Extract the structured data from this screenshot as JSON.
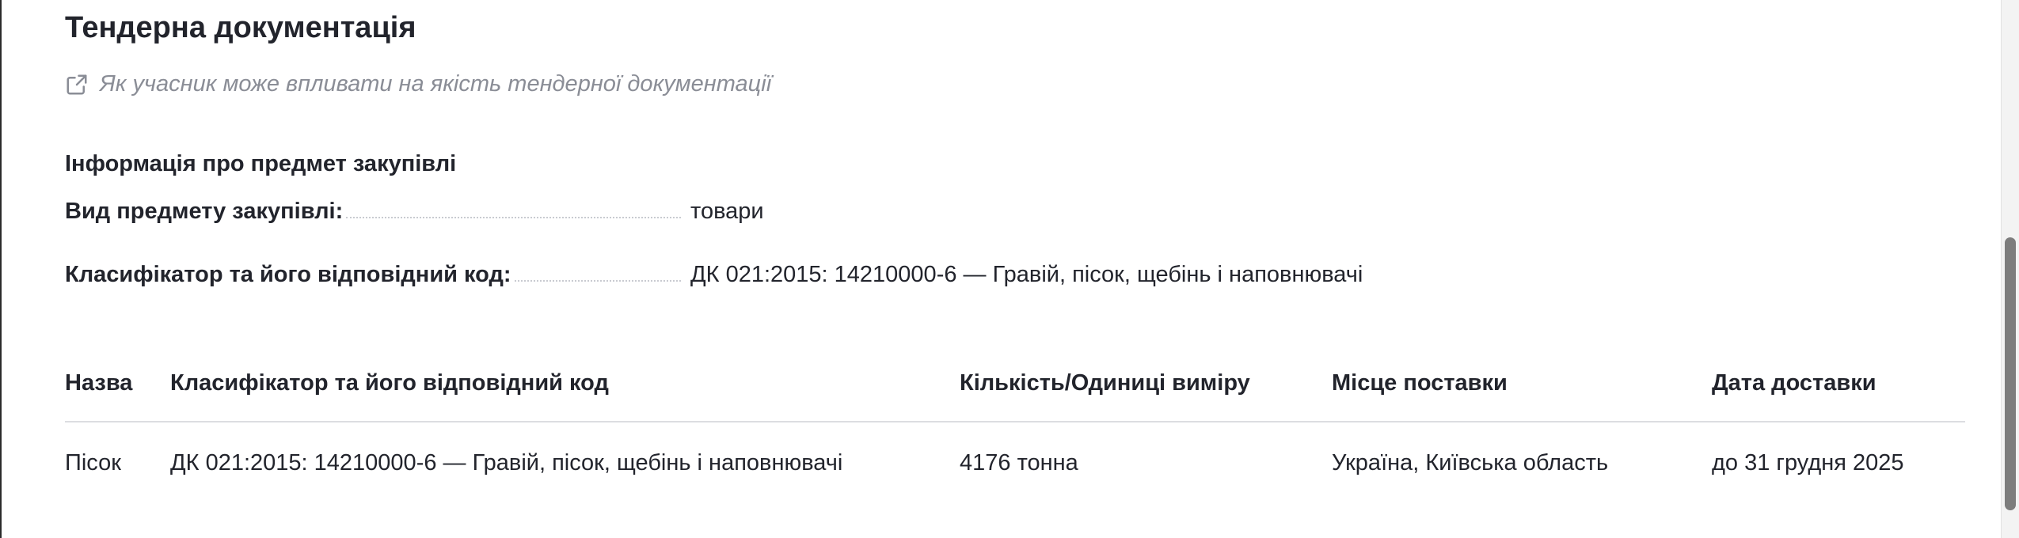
{
  "section": {
    "title": "Тендерна документація",
    "guide_link": "Як учасник може впливати на якість тендерної документації",
    "info_heading": "Інформація про предмет закупівлі",
    "fields": [
      {
        "label": "Вид предмету закупівлі:",
        "value": "товари"
      },
      {
        "label": "Класифікатор та його відповідний код:",
        "value": "ДК 021:2015: 14210000-6 — Гравій, пісок, щебінь і наповнювачі"
      }
    ]
  },
  "table": {
    "headers": [
      "Назва",
      "Класифікатор та його відповідний код",
      "Кількість/Одиниці виміру",
      "Місце поставки",
      "Дата доставки"
    ],
    "rows": [
      [
        "Пісок",
        "ДК 021:2015: 14210000-6 — Гравій, пісок, щебінь і наповнювачі",
        "4176 тонна",
        "Україна, Київська область",
        "до  31 грудня 2025"
      ]
    ]
  },
  "colors": {
    "text": "#22242c",
    "muted": "#8a8d96",
    "divider": "#dcdde1"
  },
  "icons": {
    "guide_link_icon": "external-link-icon"
  }
}
